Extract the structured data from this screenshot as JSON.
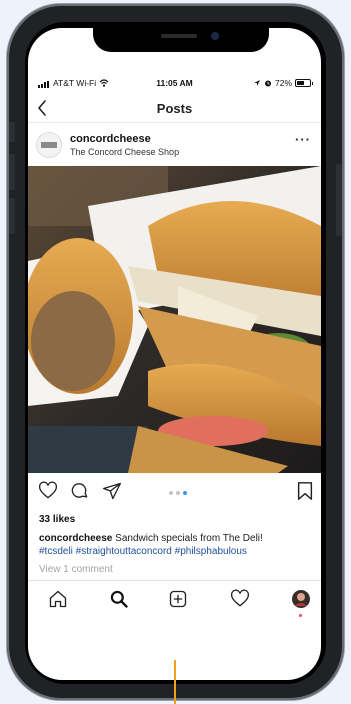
{
  "status_bar": {
    "carrier": "AT&T Wi-Fi",
    "time": "11:05 AM",
    "battery": "72%",
    "battery_level": 0.72
  },
  "navbar": {
    "back_icon": "chevron-left-icon",
    "title": "Posts"
  },
  "post": {
    "username": "concordcheese",
    "location": "The Concord Cheese Shop",
    "more_icon": "more-options-icon",
    "more_label": "···",
    "image_subject": "sandwiches wrapped in paper",
    "carousel": {
      "count": 3,
      "active": 2
    },
    "likes": "33 likes",
    "caption_user": "concordcheese",
    "caption_text": " Sandwich specials from The Deli!",
    "hashtags": "#tcsdeli #straightouttaconcord #philsphabulous",
    "view_comments": "View 1 comment"
  },
  "actions": {
    "like_icon": "heart-icon",
    "comment_icon": "comment-icon",
    "share_icon": "send-icon",
    "save_icon": "bookmark-icon"
  },
  "tabbar": {
    "items": [
      "home-icon",
      "search-icon",
      "new-post-icon",
      "activity-icon",
      "profile-avatar"
    ]
  },
  "colors": {
    "link_blue": "#1f4f9b",
    "active_dot": "#3897f0",
    "notification_dot": "#ed4956"
  }
}
